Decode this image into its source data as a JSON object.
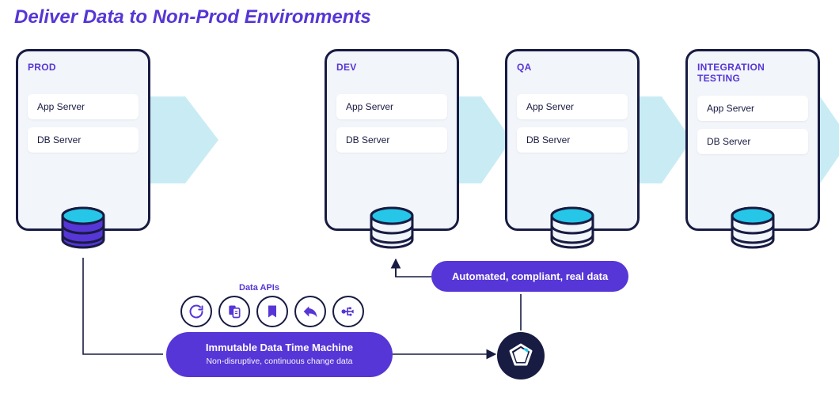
{
  "title": "Deliver Data to Non-Prod Environments",
  "environments": [
    {
      "name": "PROD",
      "app": "App Server",
      "db": "DB Server"
    },
    {
      "name": "DEV",
      "app": "App Server",
      "db": "DB Server"
    },
    {
      "name": "QA",
      "app": "App Server",
      "db": "DB Server"
    },
    {
      "name": "INTEGRATION TESTING",
      "app": "App Server",
      "db": "DB Server"
    }
  ],
  "data_apis_label": "Data APIs",
  "api_icons": [
    "refresh",
    "copy",
    "bookmark",
    "reply",
    "usb"
  ],
  "idtm": {
    "title": "Immutable Data Time Machine",
    "subtitle": "Non-disruptive, continuous change data"
  },
  "auto_pill": "Automated, compliant, real data",
  "colors": {
    "accent": "#5636D6",
    "dark": "#181B42",
    "flow": "#C9ECF4",
    "db_top": "#26C6E8"
  }
}
